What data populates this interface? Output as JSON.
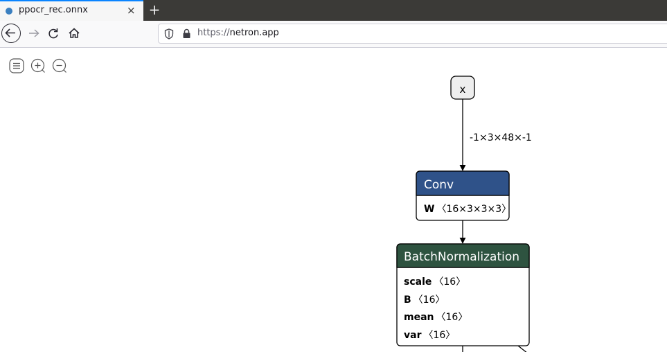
{
  "browser": {
    "tab": {
      "title": "ppocr_rec.onnx",
      "favicon": "globe-icon",
      "close": "×"
    },
    "new_tab": "+",
    "url": {
      "scheme": "https://",
      "host": "netron.app"
    }
  },
  "toolbar": {
    "menu_icon": "menu-icon",
    "zoom_in_icon": "zoom-in-icon",
    "zoom_out_icon": "zoom-out-icon"
  },
  "graph": {
    "input": {
      "name": "x"
    },
    "edge_label": "-1×3×48×-1",
    "conv": {
      "title": "Conv",
      "header_color": "#2f5289",
      "attr_name": "W",
      "attr_value": "〈16×3×3×3〉"
    },
    "bn": {
      "title": "BatchNormalization",
      "header_color": "#2e5340",
      "attrs": [
        {
          "name": "scale",
          "value": "〈16〉"
        },
        {
          "name": "B",
          "value": "〈16〉"
        },
        {
          "name": "mean",
          "value": "〈16〉"
        },
        {
          "name": "var",
          "value": "〈16〉"
        }
      ]
    }
  }
}
